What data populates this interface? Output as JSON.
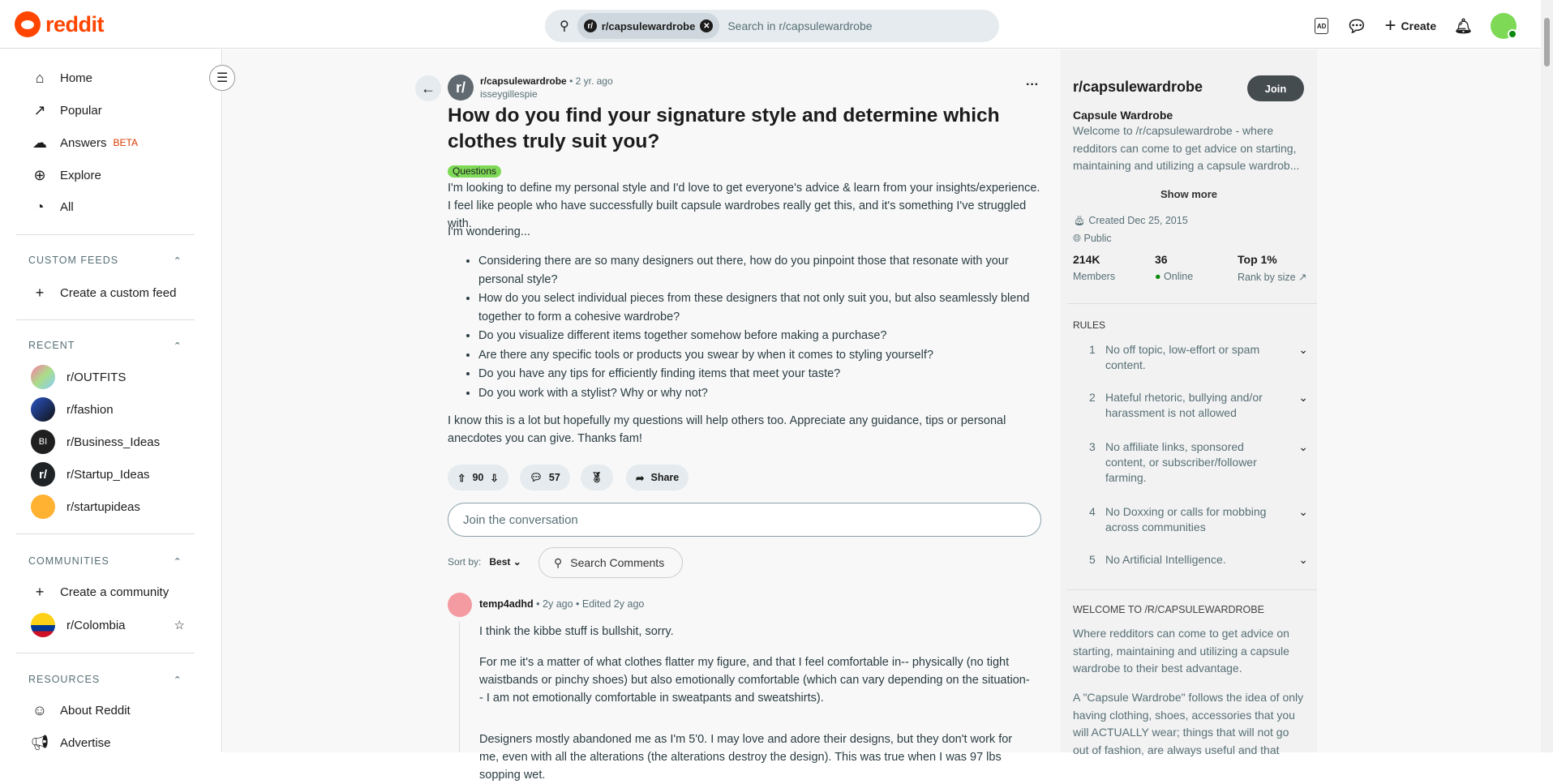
{
  "header": {
    "logo": "reddit",
    "search_chip": "r/capsulewardrobe",
    "search_placeholder": "Search in r/capsulewardrobe",
    "create_label": "Create"
  },
  "left_nav": {
    "main": [
      {
        "label": "Home",
        "icon": "home-icon"
      },
      {
        "label": "Popular",
        "icon": "popular-icon"
      },
      {
        "label": "Answers",
        "badge": "BETA",
        "icon": "answers-icon"
      },
      {
        "label": "Explore",
        "icon": "explore-icon"
      },
      {
        "label": "All",
        "icon": "all-icon"
      }
    ],
    "custom_feeds": {
      "heading": "CUSTOM FEEDS",
      "create": "Create a custom feed"
    },
    "recent": {
      "heading": "RECENT",
      "items": [
        "r/OUTFITS",
        "r/fashion",
        "r/Business_Ideas",
        "r/Startup_Ideas",
        "r/startupideas"
      ]
    },
    "communities": {
      "heading": "COMMUNITIES",
      "create": "Create a community",
      "items": [
        "r/Colombia"
      ]
    },
    "resources": {
      "heading": "RESOURCES",
      "items": [
        "About Reddit",
        "Advertise"
      ]
    }
  },
  "post": {
    "subreddit": "r/capsulewardrobe",
    "age": "• 2 yr. ago",
    "author": "isseygillespie",
    "title": "How do you find your signature style and determine which clothes truly suit you?",
    "flair": "Questions",
    "body_p1": "I'm looking to define my personal style and I'd love to get everyone's advice & learn from your insights/experience. I feel like people who have successfully built capsule wardrobes really get this, and it's something I've struggled with.",
    "body_p2": "I'm wondering...",
    "bullets": [
      "Considering there are so many designers out there, how do you pinpoint those that resonate with your personal style?",
      "How do you select individual pieces from these designers that not only suit you, but also seamlessly blend together to form a cohesive wardrobe?",
      "Do you visualize different items together somehow before making a purchase?",
      "Are there any specific tools or products you swear by when it comes to styling yourself?",
      "Do you have any tips for efficiently finding items that meet your taste?",
      "Do you work with a stylist? Why or why not?"
    ],
    "body_p3": "I know this is a lot but hopefully my questions will help others too. Appreciate any guidance, tips or personal anecdotes you can give. Thanks fam!",
    "votes": "90",
    "comments": "57",
    "share": "Share"
  },
  "comments_area": {
    "join_placeholder": "Join the conversation",
    "sort_label": "Sort by:",
    "sort_value": "Best",
    "search_comments": "Search Comments"
  },
  "comment": {
    "author": "temp4adhd",
    "age": "• 2y ago",
    "edited": "• Edited 2y ago",
    "p1": "I think the kibbe stuff is bullshit, sorry.",
    "p2": "For me it's a matter of what clothes flatter my figure, and that I feel comfortable in-- physically (no tight waistbands or pinchy shoes) but also emotionally comfortable (which can vary depending on the situation-- I am not emotionally comfortable in sweatpants and sweatshirts).",
    "p3": "Designers mostly abandoned me as I'm 5'0. I may love and adore their designs, but they don't work for me, even with all the alterations (the alterations destroy the design). This was true when I was 97 lbs sopping wet."
  },
  "sidebar": {
    "name": "r/capsulewardrobe",
    "join": "Join",
    "title": "Capsule Wardrobe",
    "description": "Welcome to /r/capsulewardrobe - where redditors can come to get advice on starting, maintaining and utilizing a capsule wardrob...",
    "show_more": "Show more",
    "created": "Created Dec 25, 2015",
    "visibility": "Public",
    "stats": [
      {
        "value": "214K",
        "label": "Members"
      },
      {
        "value": "36",
        "label": "Online"
      },
      {
        "value": "Top 1%",
        "label": "Rank by size"
      }
    ],
    "rules_heading": "RULES",
    "rules": [
      {
        "n": "1",
        "text": "No off topic, low-effort or spam content."
      },
      {
        "n": "2",
        "text": "Hateful rhetoric, bullying and/or harassment is not allowed"
      },
      {
        "n": "3",
        "text": "No affiliate links, sponsored content, or subscriber/follower farming."
      },
      {
        "n": "4",
        "text": "No Doxxing or calls for mobbing across communities"
      },
      {
        "n": "5",
        "text": "No Artificial Intelligence."
      }
    ],
    "welcome_heading": "WELCOME TO /R/CAPSULEWARDROBE",
    "welcome_p1": "Where redditors can come to get advice on starting, maintaining and utilizing a capsule wardrobe to their best advantage.",
    "welcome_p2": "A \"Capsule Wardrobe\" follows the idea of only having clothing, shoes, accessories that you will ACTUALLY wear; things that will not go out of fashion, are always useful and that"
  },
  "colors": {
    "brand": "#ff4500",
    "flair": "#7ed957",
    "online": "#0a8a0a"
  }
}
